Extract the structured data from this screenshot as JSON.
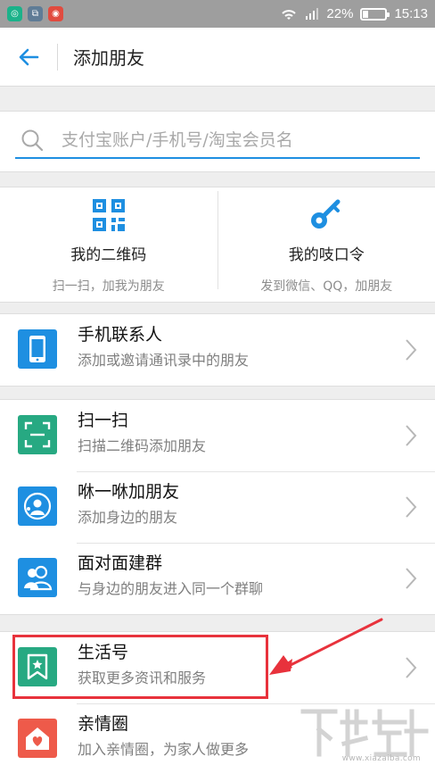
{
  "status_bar": {
    "apps": [
      {
        "name": "green-app-icon",
        "color": "#1bb28a",
        "glyph": "◎"
      },
      {
        "name": "gray-app-icon",
        "color": "#5f7c96",
        "glyph": "⧉"
      },
      {
        "name": "weibo-icon",
        "color": "#e14b3f",
        "glyph": "◉"
      }
    ],
    "battery_text": "22%",
    "battery_level": 0.22,
    "time": "15:13"
  },
  "header": {
    "title": "添加朋友"
  },
  "search": {
    "placeholder": "支付宝账户/手机号/淘宝会员名"
  },
  "cards": [
    {
      "title": "我的二维码",
      "subtitle": "扫一扫，加我为朋友",
      "icon": "qr-code-icon"
    },
    {
      "title": "我的吱口令",
      "subtitle": "发到微信、QQ，加朋友",
      "icon": "key-icon"
    }
  ],
  "sections": [
    {
      "items": [
        {
          "title": "手机联系人",
          "subtitle": "添加或邀请通讯录中的朋友",
          "icon": "phone-icon",
          "color": "#1e8fe1"
        }
      ]
    },
    {
      "items": [
        {
          "title": "扫一扫",
          "subtitle": "扫描二维码添加朋友",
          "icon": "scan-icon",
          "color": "#27a982"
        },
        {
          "title": "咻一咻加朋友",
          "subtitle": "添加身边的朋友",
          "icon": "radar-icon",
          "color": "#1e8fe1"
        },
        {
          "title": "面对面建群",
          "subtitle": "与身边的朋友进入同一个群聊",
          "icon": "group-icon",
          "color": "#1e8fe1"
        }
      ]
    },
    {
      "items": [
        {
          "title": "生活号",
          "subtitle": "获取更多资讯和服务",
          "icon": "bookmark-star-icon",
          "color": "#27a982"
        },
        {
          "title": "亲情圈",
          "subtitle": "加入亲情圈，为家人做更多",
          "icon": "home-heart-icon",
          "color": "#ee5a4a"
        }
      ]
    }
  ],
  "colors": {
    "accent": "#1e8fe1",
    "highlight": "#e8323c"
  },
  "watermark": {
    "text": "www.xiazaiba.com"
  }
}
